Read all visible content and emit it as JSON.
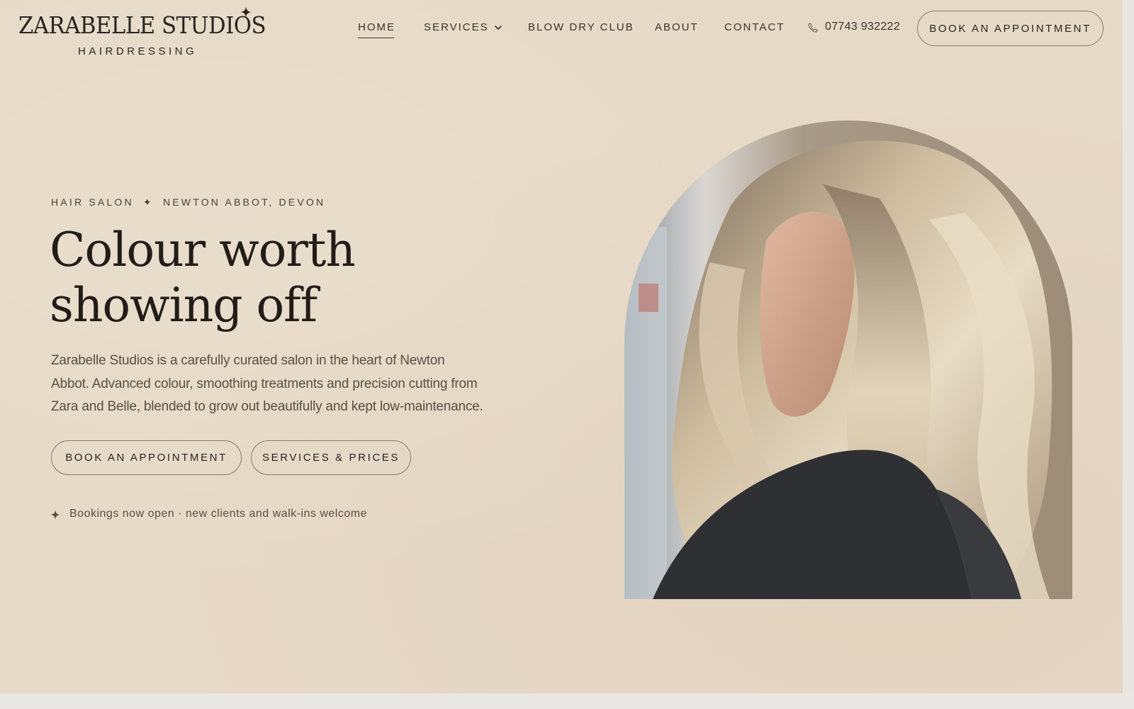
{
  "brand": {
    "name": "ZARABELLE STUDIOS",
    "tagline": "HAIRDRESSING",
    "logo_icon": "sparkle-star-icon"
  },
  "nav": {
    "items": [
      {
        "label": "HOME",
        "active": true
      },
      {
        "label": "SERVICES",
        "has_dropdown": true
      },
      {
        "label": "BLOW DRY CLUB"
      },
      {
        "label": "ABOUT"
      },
      {
        "label": "CONTACT"
      }
    ],
    "phone_icon": "phone-icon",
    "phone": "07743 932222",
    "cta_label": "BOOK AN APPOINTMENT"
  },
  "hero": {
    "eyebrow_left": "HAIR SALON",
    "eyebrow_sep": "✦",
    "eyebrow_right": "NEWTON ABBOT, DEVON",
    "headline_line1": "Colour worth",
    "headline_line2": "showing off",
    "intro": "Zarabelle Studios is a carefully curated salon in the heart of Newton Abbot. Advanced colour, smoothing treatments and precision cutting from Zara and Belle, blended to grow out beautifully and kept low-maintenance.",
    "primary_button": "BOOK AN APPOINTMENT",
    "secondary_button": "SERVICES & PRICES",
    "note_icon": "sparkle-star-icon",
    "note": "Bookings now open · new clients and walk-ins welcome",
    "photo_subject": "woman with long wavy blonde balayage hair looking down"
  },
  "colors": {
    "background": "#e6d9c6",
    "text": "#2a2520",
    "button_border": "#8d7a64"
  }
}
